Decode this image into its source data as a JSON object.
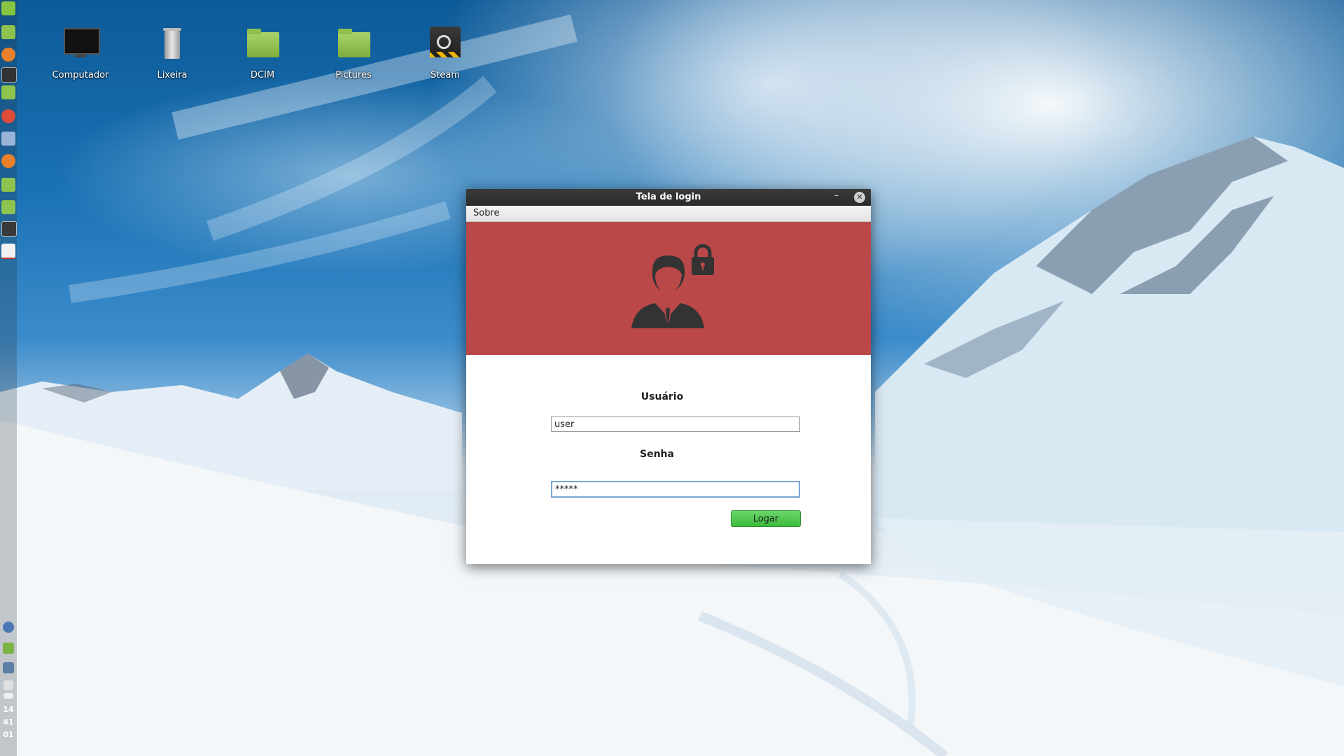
{
  "desktop": {
    "icons": [
      {
        "label": "Computador",
        "icon": "monitor-icon"
      },
      {
        "label": "Lixeira",
        "icon": "trash-icon"
      },
      {
        "label": "DCIM",
        "icon": "folder-icon"
      },
      {
        "label": "Pictures",
        "icon": "folder-icon"
      },
      {
        "label": "Steam",
        "icon": "steam-icon"
      }
    ]
  },
  "panel": {
    "clock": {
      "hour": "14",
      "minute": "41",
      "second": "01"
    },
    "launchers": [
      "mint-menu-icon",
      "desktop-icon",
      "firefox-icon",
      "terminal-icon",
      "files-icon",
      "chrome-icon",
      "virtualbox-icon",
      "firefox-icon",
      "folder-icon",
      "folder-icon",
      "media-player-icon",
      "java-app-icon"
    ],
    "tray": [
      "bluetooth-icon",
      "update-shield-icon",
      "network-icon",
      "sound-icon",
      "pen-icon"
    ]
  },
  "window": {
    "title": "Tela de login",
    "minimize_label": "–",
    "close_label": "✕",
    "menu": {
      "about": "Sobre"
    },
    "form": {
      "user_label": "Usuário",
      "user_value": "user",
      "pass_label": "Senha",
      "pass_value": "*****",
      "login_button": "Logar"
    }
  },
  "colors": {
    "banner": "#bb4848",
    "login_button": "#4cc44c",
    "titlebar": "#2f2f2f"
  }
}
